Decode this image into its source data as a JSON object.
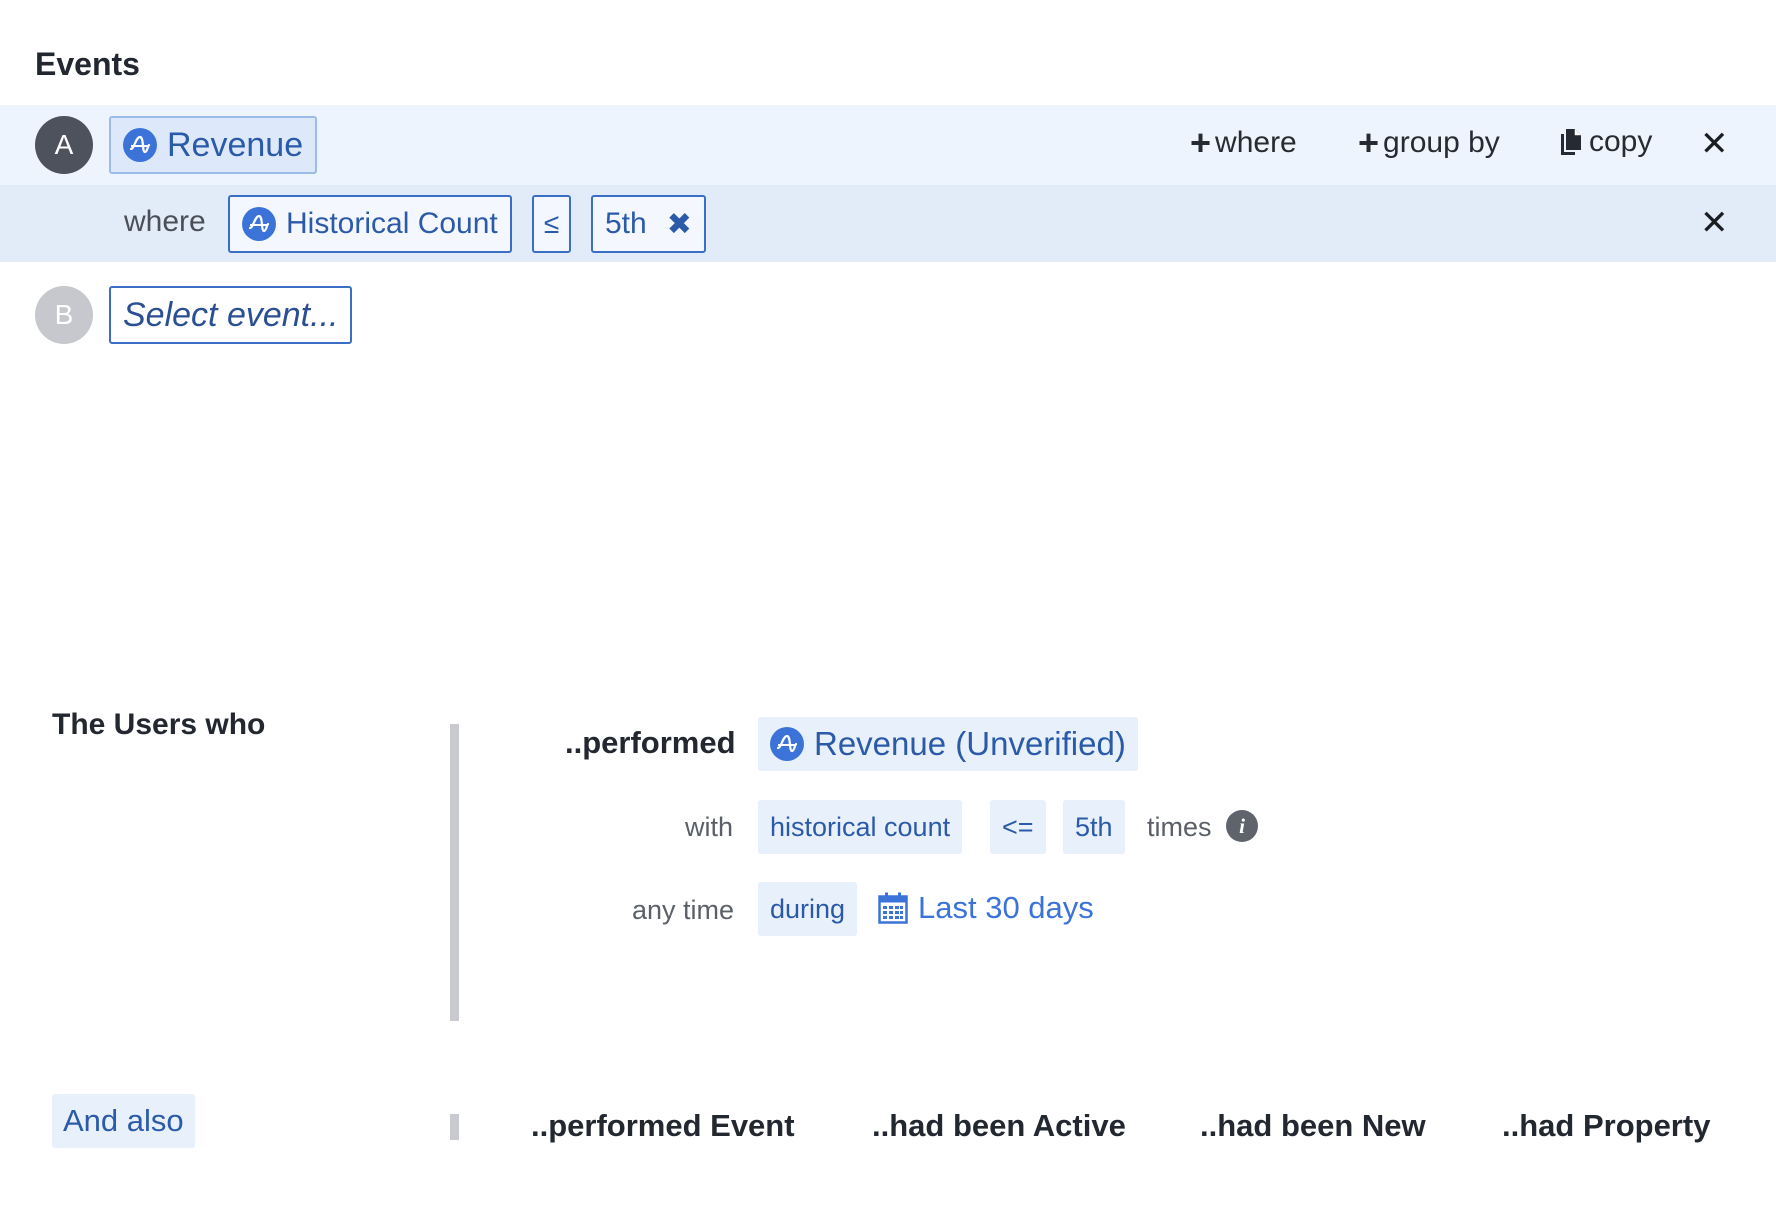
{
  "events": {
    "title": "Events",
    "rows": [
      {
        "letter": "A",
        "event": "Revenue"
      },
      {
        "letter": "B",
        "placeholder": "Select event..."
      }
    ],
    "actions": {
      "where": "where",
      "group_by": "group by",
      "copy": "copy"
    },
    "filter": {
      "label": "where",
      "property": "Historical Count",
      "operator": "≤",
      "value": "5th"
    }
  },
  "segment": {
    "title": "The Users who",
    "performed_label": "..performed",
    "event": "Revenue (Unverified)",
    "with_label": "with",
    "property": "historical count",
    "operator": "<=",
    "value": "5th",
    "times_label": "times",
    "info_glyph": "i",
    "anytime_label": "any time",
    "during_label": "during",
    "date_range": "Last 30 days"
  },
  "and_also": {
    "label": "And also",
    "options": [
      "..performed Event",
      "..had been Active",
      "..had been New",
      "..had Property"
    ]
  },
  "colors": {
    "accent": "#3b73d9",
    "chip_bg": "#e8f0fb",
    "row_a_bg": "#eef4fd",
    "row_where_bg": "#e2ebf8"
  },
  "icons": [
    "amplitude-icon",
    "plus-icon",
    "copy-icon",
    "close-icon",
    "info-icon",
    "calendar-icon"
  ]
}
